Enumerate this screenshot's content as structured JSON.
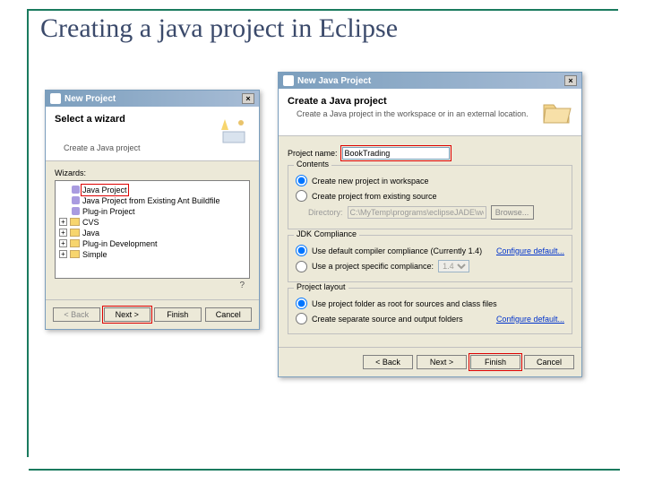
{
  "slide": {
    "title": "Creating a java project in Eclipse"
  },
  "dlg1": {
    "title": "New Project",
    "banner_title": "Select a wizard",
    "banner_sub": "Create a Java project",
    "wizards_label": "Wizards:",
    "tree": {
      "item1": "Java Project",
      "item2": "Java Project from Existing Ant Buildfile",
      "item3": "Plug-in Project",
      "item4": "CVS",
      "item5": "Java",
      "item6": "Plug-in Development",
      "item7": "Simple"
    },
    "buttons": {
      "back": "< Back",
      "next": "Next >",
      "finish": "Finish",
      "cancel": "Cancel"
    }
  },
  "dlg2": {
    "title": "New Java Project",
    "banner_title": "Create a Java project",
    "banner_sub": "Create a Java project in the workspace or in an external location.",
    "project_name_label": "Project name:",
    "project_name_value": "BookTrading",
    "contents": {
      "legend": "Contents",
      "opt1": "Create new project in workspace",
      "opt2": "Create project from existing source",
      "dir_label": "Directory:",
      "dir_value": "C:\\MyTemp\\programs\\eclipseJADE\\workspa",
      "browse": "Browse..."
    },
    "jdk": {
      "legend": "JDK Compliance",
      "opt1": "Use default compiler compliance (Currently 1.4)",
      "opt2": "Use a project specific compliance:",
      "select_val": "1.4",
      "link": "Configure default..."
    },
    "layout": {
      "legend": "Project layout",
      "opt1": "Use project folder as root for sources and class files",
      "opt2": "Create separate source and output folders",
      "link": "Configure default..."
    },
    "buttons": {
      "back": "< Back",
      "next": "Next >",
      "finish": "Finish",
      "cancel": "Cancel"
    }
  }
}
